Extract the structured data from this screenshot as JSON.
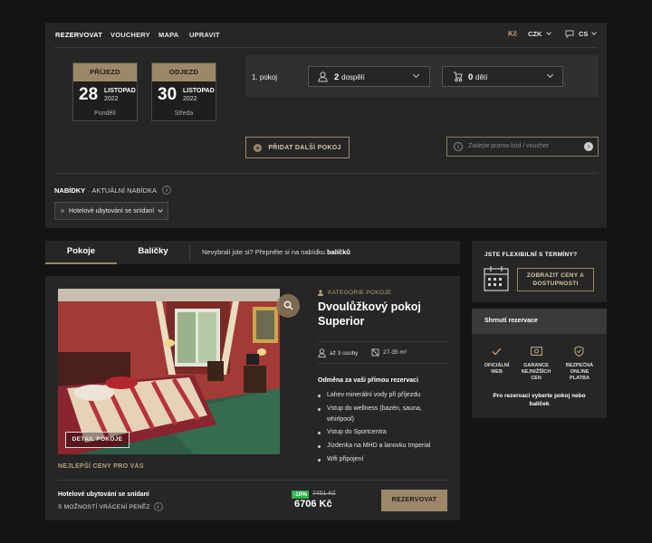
{
  "nav": {
    "items": [
      "REZERVOVAT",
      "VOUCHERY",
      "MAPA",
      "UPRAVIT"
    ],
    "currency_symbol": "Kč",
    "currency": "CZK",
    "language": "CS"
  },
  "booking": {
    "arrival": {
      "header": "PŘÍJEZD",
      "day": "28",
      "month": "LISTOPAD",
      "year": "2022",
      "weekday": "Pondělí"
    },
    "departure": {
      "header": "ODJEZD",
      "day": "30",
      "month": "LISTOPAD",
      "year": "2022",
      "weekday": "Středa"
    },
    "room_label": "1. pokoj",
    "adults_count": "2",
    "adults_label": "dospělí",
    "children_count": "0",
    "children_label": "dětí",
    "add_room": "PŘIDAT DALŠÍ POKOJ",
    "promo_placeholder": "Zadejte promo kód / voucher"
  },
  "offers": {
    "label": "NABÍDKY",
    "current": "· AKTUÁLNÍ NABÍDKA",
    "selected": "Hotelové ubytování se snídaní"
  },
  "tabs": {
    "rooms": "Pokoje",
    "packages": "Balíčky",
    "hint_prefix": "Nevybrali jste si? Přepněte si na nabídku ",
    "hint_link": "balíčků"
  },
  "room": {
    "category": "KATEGORIE POKOJE",
    "title_line1": "Dvoulůžkový pokoj",
    "title_line2": "Superior",
    "persons": "až 3 osoby",
    "size": "27-35 m²",
    "detail_button": "DETAIL POKOJE",
    "best_price": "NEJLEPŠÍ CENY PRO VÁS",
    "reward_title": "Odměna za vaši přímou rezervaci",
    "features": [
      "Lahev minerální vody při příjezdu",
      "Vstup do wellness (bazén, sauna,",
      "whirlpool)",
      "Vstup do Sportcentra",
      "Jízdenka na MHD a lanovku Imperial",
      "Wifi připojení"
    ],
    "rate_name": "Hotelové ubytování se snídaní",
    "rate_note": "S MOŽNOSTÍ VRÁCENÍ PENĚZ",
    "discount": "-10%",
    "old_price": "7451 Kč",
    "price": "6706 Kč",
    "book_button": "REZERVOVAT"
  },
  "sidebar": {
    "flexible_title": "JSTE FLEXIBILNÍ S TERMÍNY?",
    "show_prices": "ZOBRAZIT CENY A DOSTUPNOSTI",
    "summary_title": "Shrnutí rezervace",
    "benefits": [
      "OFICIÁLNÍ WEB",
      "GARANCE NEJNIŽŠÍCH CEN",
      "BEZPEČNÁ ONLINE PLATBA"
    ],
    "select_prompt": "Pro rezervaci vyberte pokoj nebo balíček"
  },
  "colors": {
    "accent": "#9c8868",
    "panel": "#262626",
    "background": "#141414",
    "discount": "#2bb24c"
  }
}
